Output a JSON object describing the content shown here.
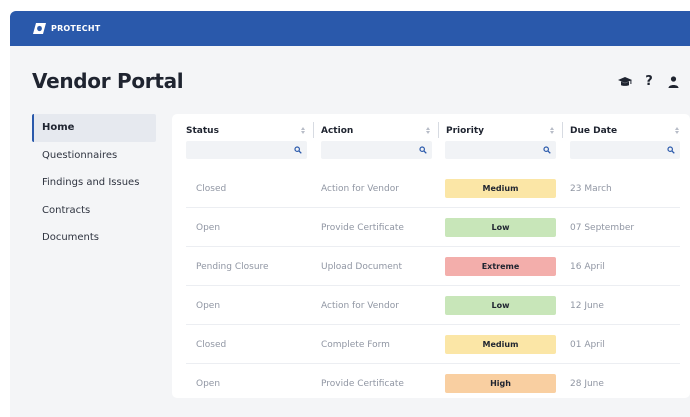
{
  "app": {
    "brand": "PROTECHT",
    "page_title": "Vendor Portal"
  },
  "header_icons": [
    {
      "name": "graduation-cap-icon"
    },
    {
      "name": "help-icon",
      "glyph": "?"
    },
    {
      "name": "user-icon"
    }
  ],
  "sidebar": {
    "items": [
      {
        "label": "Home",
        "active": true
      },
      {
        "label": "Questionnaires",
        "active": false
      },
      {
        "label": "Findings and Issues",
        "active": false
      },
      {
        "label": "Contracts",
        "active": false
      },
      {
        "label": "Documents",
        "active": false
      }
    ]
  },
  "table": {
    "columns": [
      {
        "label": "Status",
        "filter_value": "",
        "filter_placeholder": ""
      },
      {
        "label": "Action",
        "filter_value": "",
        "filter_placeholder": ""
      },
      {
        "label": "Priority",
        "filter_value": "",
        "filter_placeholder": ""
      },
      {
        "label": "Due Date",
        "filter_value": "",
        "filter_placeholder": ""
      }
    ],
    "rows": [
      {
        "status": "Closed",
        "action": "Action for Vendor",
        "priority": "Medium",
        "due": "23 March"
      },
      {
        "status": "Open",
        "action": "Provide Certificate",
        "priority": "Low",
        "due": "07 September"
      },
      {
        "status": "Pending Closure",
        "action": "Upload Document",
        "priority": "Extreme",
        "due": "16 April"
      },
      {
        "status": "Open",
        "action": "Action for Vendor",
        "priority": "Low",
        "due": "12 June"
      },
      {
        "status": "Closed",
        "action": "Complete Form",
        "priority": "Medium",
        "due": "01 April"
      },
      {
        "status": "Open",
        "action": "Provide Certificate",
        "priority": "High",
        "due": "28 June"
      }
    ]
  },
  "colors": {
    "brand": "#2a59ab",
    "priority": {
      "Low": "#c8e6b9",
      "Medium": "#fbe6a6",
      "High": "#f9cfa1",
      "Extreme": "#f3aeab"
    }
  }
}
